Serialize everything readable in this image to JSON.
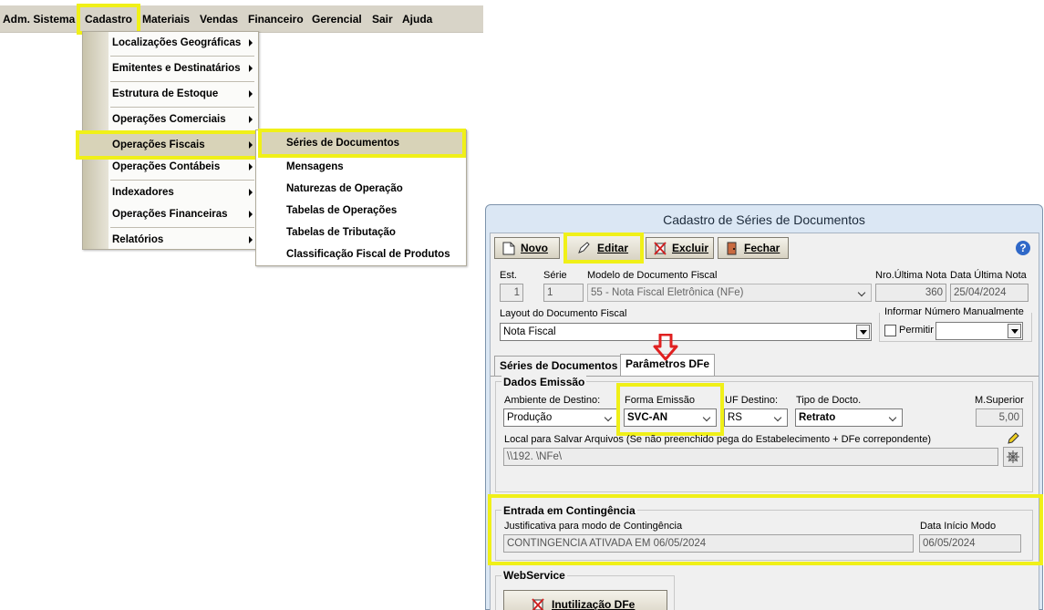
{
  "menubar": {
    "items": [
      "Adm. Sistema",
      "Cadastro",
      "Materiais",
      "Vendas",
      "Financeiro",
      "Gerencial",
      "Sair",
      "Ajuda"
    ]
  },
  "cadastro_menu": {
    "items": [
      "Localizações Geográficas",
      "Emitentes e Destinatários",
      "Estrutura de Estoque",
      "Operações Comerciais",
      "Operações Fiscais",
      "Operações Contábeis",
      "Indexadores",
      "Operações Financeiras",
      "Relatórios"
    ]
  },
  "fiscal_submenu": {
    "items": [
      "Séries de Documentos",
      "Mensagens",
      "Naturezas de Operação",
      "Tabelas de Operações",
      "Tabelas de Tributação",
      "Classificação Fiscal de Produtos"
    ]
  },
  "dialog": {
    "title": "Cadastro de Séries de Documentos",
    "toolbar": {
      "novo": "Novo",
      "editar": "Editar",
      "excluir": "Excluir",
      "fechar": "Fechar",
      "help": "?"
    },
    "header": {
      "est_label": "Est.",
      "est_value": "1",
      "serie_label": "Série",
      "serie_value": "1",
      "modelo_label": "Modelo de Documento Fiscal",
      "modelo_value": "55 - Nota Fiscal Eletrônica (NFe)",
      "nro_label": "Nro.Última Nota",
      "nro_value": "360",
      "data_ult_label": "Data Última Nota",
      "data_ult_value": "25/04/2024",
      "layout_label": "Layout do Documento Fiscal",
      "layout_value": "Nota Fiscal",
      "informar_label": "Informar Número Manualmente",
      "permitir_label": "Permitir"
    },
    "tabs": [
      "Séries de Documentos",
      "Parâmetros DFe"
    ],
    "dados_emissao": {
      "title": "Dados Emissão",
      "ambiente_label": "Ambiente de Destino:",
      "ambiente_value": "Produção",
      "forma_label": "Forma Emissão",
      "forma_value": "SVC-AN",
      "uf_label": "UF Destino:",
      "uf_value": "RS",
      "tipo_label": "Tipo de Docto.",
      "tipo_value": "Retrato",
      "msup_label": "M.Superior",
      "msup_value": "5,00",
      "local_label": "Local para Salvar Arquivos (Se não preenchido pega do Estabelecimento + DFe correpondente)",
      "local_value": "\\\\192.              \\NFe\\"
    },
    "contingencia": {
      "title": "Entrada em Contingência",
      "just_label": "Justificativa para modo de Contingência",
      "just_value": "CONTINGENCIA ATIVADA EM 06/05/2024",
      "data_label": "Data Início Modo",
      "data_value": "06/05/2024"
    },
    "webservice": {
      "title": "WebService",
      "inut_button": "Inutilização DFe"
    }
  },
  "colors": {
    "highlight": "#f0f018",
    "arrow": "#e02020",
    "menubar": "#d8d4c8",
    "title_bar": "#dbe7f4"
  }
}
